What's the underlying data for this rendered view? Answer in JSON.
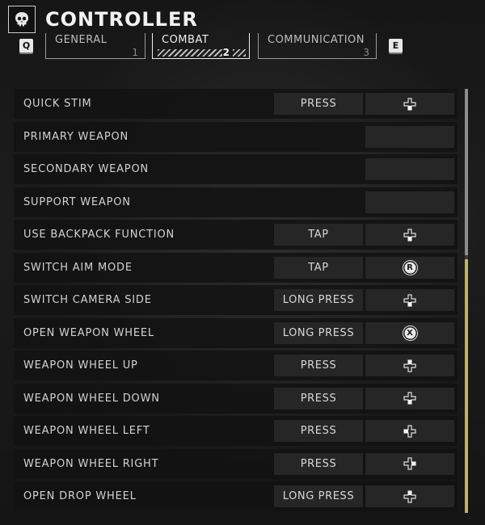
{
  "header": {
    "title": "CONTROLLER",
    "logo_icon": "skull-icon"
  },
  "nav": {
    "prev_key": "Q",
    "next_key": "E"
  },
  "tabs": [
    {
      "label": "GENERAL",
      "number": "1",
      "active": false
    },
    {
      "label": "COMBAT",
      "number": "2",
      "active": true
    },
    {
      "label": "COMMUNICATION",
      "number": "3",
      "active": false
    }
  ],
  "rows": [
    {
      "label": "QUICK STIM",
      "action": "PRESS",
      "binding": "dpad-down-icon"
    },
    {
      "label": "PRIMARY WEAPON",
      "action": "",
      "binding": ""
    },
    {
      "label": "SECONDARY WEAPON",
      "action": "",
      "binding": ""
    },
    {
      "label": "SUPPORT WEAPON",
      "action": "",
      "binding": ""
    },
    {
      "label": "USE BACKPACK FUNCTION",
      "action": "TAP",
      "binding": "dpad-down-icon"
    },
    {
      "label": "SWITCH AIM MODE",
      "action": "TAP",
      "binding": "r-button-icon",
      "binding_text": "R"
    },
    {
      "label": "SWITCH CAMERA SIDE",
      "action": "LONG PRESS",
      "binding": "dpad-down-icon"
    },
    {
      "label": "OPEN WEAPON WHEEL",
      "action": "LONG PRESS",
      "binding": "x-button-icon",
      "binding_text": "X"
    },
    {
      "label": "WEAPON WHEEL UP",
      "action": "PRESS",
      "binding": "dpad-up-icon"
    },
    {
      "label": "WEAPON WHEEL DOWN",
      "action": "PRESS",
      "binding": "dpad-down-icon"
    },
    {
      "label": "WEAPON WHEEL LEFT",
      "action": "PRESS",
      "binding": "dpad-left-icon"
    },
    {
      "label": "WEAPON WHEEL RIGHT",
      "action": "PRESS",
      "binding": "dpad-right-icon"
    },
    {
      "label": "OPEN DROP WHEEL",
      "action": "LONG PRESS",
      "binding": "dpad-up-icon"
    }
  ],
  "colors": {
    "accent": "#bfb36a",
    "row_bg": "#121212",
    "button_bg": "#262626"
  }
}
